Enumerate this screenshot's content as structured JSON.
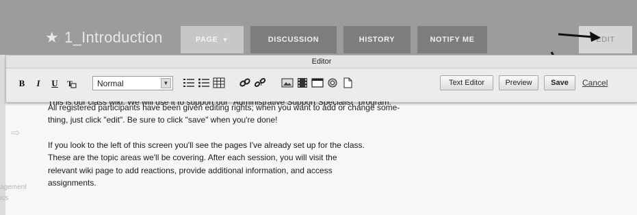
{
  "wiki": {
    "title": "1_Introduction",
    "star": "★"
  },
  "tabs": {
    "page": "PAGE",
    "discussion": "DISCUSSION",
    "history": "HISTORY",
    "notify": "NOTIFY ME",
    "edit": "EDIT"
  },
  "editor": {
    "title": "Editor",
    "format_buttons": {
      "bold": "B",
      "italic": "I",
      "underline": "U",
      "clear": "T"
    },
    "style_select": {
      "value": "Normal"
    },
    "buttons": {
      "text_editor": "Text Editor",
      "preview": "Preview",
      "save": "Save",
      "cancel": "Cancel"
    }
  },
  "content": {
    "cut_line": "This is our class wiki. We will use it to support our \"Administrative Support Specialist\" program.",
    "para1": [
      "All registered participants have been given editing rights; when you want to add or change some-",
      "thing, just click \"edit\". Be sure to click \"save\" when you're done!"
    ],
    "para2": [
      "If you look to the left of this screen you'll see the pages I've already set up for the class.",
      "These are the topic areas we'll be covering. After each session, you will visit the",
      "relevant wiki page to add reactions, provide additional information, and access",
      "assignments."
    ]
  },
  "sidebar": {
    "snippet_1": "agement",
    "snippet_2": "ics"
  },
  "colors": {
    "topbar": "#9c9c9c",
    "tab_dark": "#7d7d7d",
    "tab_active": "#c7c7c7",
    "editor_bg": "#ececec"
  }
}
